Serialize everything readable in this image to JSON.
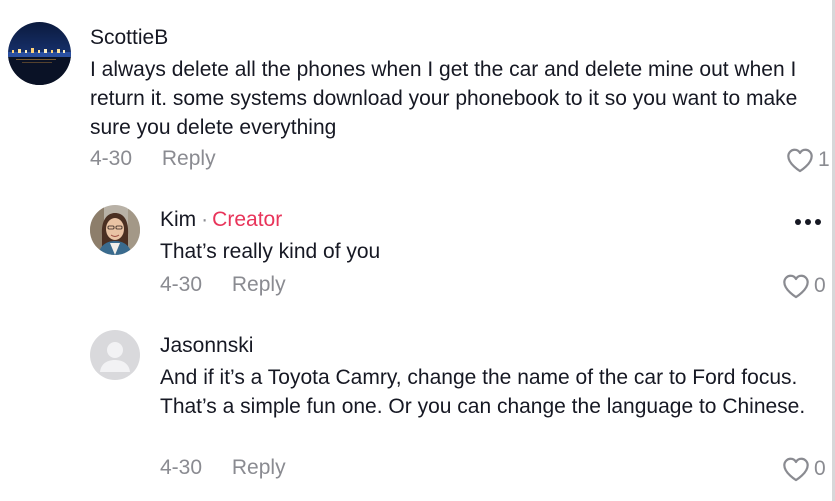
{
  "comments": [
    {
      "username": "ScottieB",
      "text": "I always delete all the phones when I get the car and delete mine out when I return it. some systems download your phonebook to it so you want to make sure you delete everything",
      "date": "4-30",
      "reply_label": "Reply",
      "likes": "1"
    },
    {
      "username": "Kim",
      "creator_separator": "·",
      "creator_label": "Creator",
      "text": "That’s really kind of you",
      "date": "4-30",
      "reply_label": "Reply",
      "likes": "0"
    },
    {
      "username": "Jasonnski",
      "text": "And if it’s a Toyota Camry, change the name of the car to Ford focus. That’s a simple fun one. Or you can change the language to Chinese.",
      "date": "4-30",
      "reply_label": "Reply",
      "likes": "0"
    }
  ],
  "icons": {
    "like": "heart-outline-icon",
    "more": "more-horizontal-icon",
    "default_avatar": "person-silhouette-icon"
  },
  "colors": {
    "text": "#161823",
    "secondary": "#8a8b91",
    "creator": "#e8345a"
  }
}
